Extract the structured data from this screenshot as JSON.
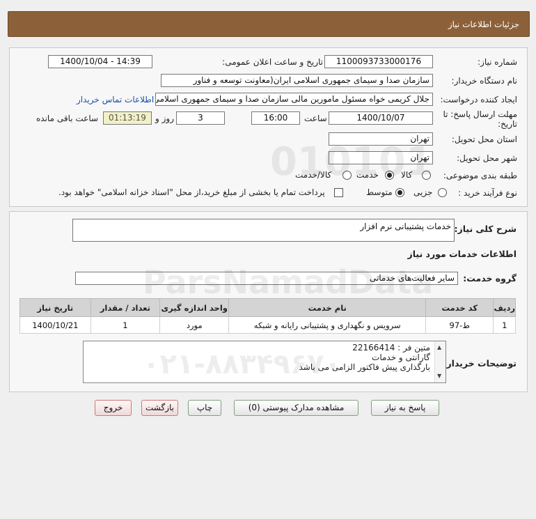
{
  "header": {
    "title": "جزئیات اطلاعات نیاز"
  },
  "form": {
    "need_number_label": "شماره نیاز:",
    "need_number": "1100093733000176",
    "announce_label": "تاریخ و ساعت اعلان عمومی:",
    "announce_value": "1400/10/04 - 14:39",
    "buyer_org_label": "نام دستگاه خریدار:",
    "buyer_org": "سازمان صدا و سیمای جمهوری اسلامی ایران(معاونت توسعه و فناور",
    "requester_label": "ایجاد کننده درخواست:",
    "requester": "جلال کریمی خواه مسئول مامورین مالی  سازمان صدا و سیمای جمهوری اسلامی",
    "contact_link": "اطلاعات تماس خریدار",
    "deadline_label_1": "مهلت ارسال پاسخ: تا",
    "deadline_label_2": "تاریخ:",
    "deadline_date": "1400/10/07",
    "time_label": "ساعت",
    "deadline_time": "16:00",
    "days_value": "3",
    "days_label": "روز و",
    "remaining_time": "01:13:19",
    "remaining_label": "ساعت باقی مانده",
    "province_label": "استان محل تحویل:",
    "province": "تهران",
    "city_label": "شهر محل تحویل:",
    "city": "تهران",
    "category_label": "طبقه بندی موضوعی:",
    "category_options": [
      "کالا",
      "خدمت",
      "کالا/خدمت"
    ],
    "category_selected": "خدمت",
    "process_label": "نوع فرآیند خرید :",
    "process_options": [
      "جزیی",
      "متوسط"
    ],
    "process_selected": "متوسط",
    "payment_note": "پرداخت تمام یا بخشی از مبلغ خرید،از محل \"اسناد خزانه اسلامی\" خواهد بود."
  },
  "summary": {
    "label": "شرح کلی نیاز:",
    "value": "خدمات پشتیبانی نرم افزار"
  },
  "services": {
    "section_title": "اطلاعات خدمات مورد نیاز",
    "group_label": "گروه خدمت:",
    "group_value": "سایر فعالیت‌های خدماتی",
    "columns": [
      "ردیف",
      "کد خدمت",
      "نام خدمت",
      "واحد اندازه گیری",
      "تعداد / مقدار",
      "تاریخ نیاز"
    ],
    "rows": [
      {
        "row": "1",
        "code": "ط-97",
        "name": "سرویس و نگهداری و پشتیبانی رایانه و شبکه",
        "unit": "مورد",
        "qty": "1",
        "date": "1400/10/21"
      }
    ]
  },
  "buyer_notes": {
    "label": "توضیحات خریدار:",
    "lines": [
      "متین فر : 22166414",
      "گارانتی و خدمات",
      "بارگذاری پیش فاکتور الزامی می باشد"
    ]
  },
  "buttons": {
    "reply": "پاسخ به نیاز",
    "attachments": "مشاهده مدارک پیوستی (0)",
    "print": "چاپ",
    "back": "بازگشت",
    "exit": "خروج"
  }
}
